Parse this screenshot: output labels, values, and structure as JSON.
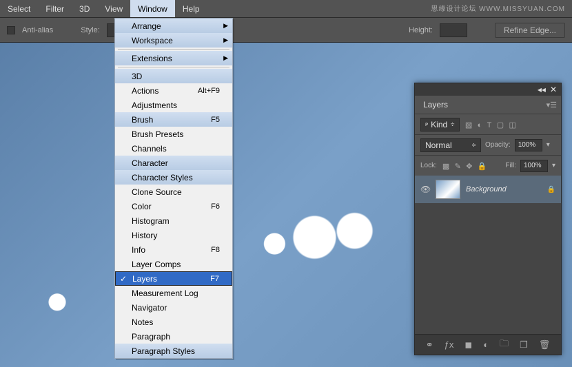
{
  "watermark": "思缘设计论坛  WWW.MISSYUAN.COM",
  "menubar": {
    "items": [
      "Select",
      "Filter",
      "3D",
      "View",
      "Window",
      "Help"
    ],
    "open_index": 4
  },
  "optbar": {
    "antialias": "Anti-alias",
    "style": "Style:",
    "height_label": "Height:",
    "refine": "Refine Edge..."
  },
  "dropdown": {
    "sections": [
      [
        {
          "label": "Arrange",
          "arrow": true,
          "hl": true
        },
        {
          "label": "Workspace",
          "arrow": true,
          "hl": true
        }
      ],
      [
        {
          "label": "Extensions",
          "arrow": true,
          "hl": true
        }
      ],
      [
        {
          "label": "3D",
          "hl": true
        },
        {
          "label": "Actions",
          "shortcut": "Alt+F9"
        },
        {
          "label": "Adjustments"
        },
        {
          "label": "Brush",
          "shortcut": "F5",
          "hl": true
        },
        {
          "label": "Brush Presets"
        },
        {
          "label": "Channels"
        },
        {
          "label": "Character",
          "hl": true
        },
        {
          "label": "Character Styles",
          "hl": true
        },
        {
          "label": "Clone Source"
        },
        {
          "label": "Color",
          "shortcut": "F6"
        },
        {
          "label": "Histogram"
        },
        {
          "label": "History"
        },
        {
          "label": "Info",
          "shortcut": "F8"
        },
        {
          "label": "Layer Comps"
        },
        {
          "label": "Layers",
          "shortcut": "F7",
          "sel": true,
          "check": true
        },
        {
          "label": "Measurement Log"
        },
        {
          "label": "Navigator"
        },
        {
          "label": "Notes"
        },
        {
          "label": "Paragraph"
        },
        {
          "label": "Paragraph Styles",
          "hl": true
        }
      ]
    ]
  },
  "panel": {
    "tab": "Layers",
    "kind": "Kind",
    "blend": "Normal",
    "opacity_label": "Opacity:",
    "opacity_value": "100%",
    "lock_label": "Lock:",
    "fill_label": "Fill:",
    "fill_value": "100%",
    "layer": {
      "name": "Background"
    }
  }
}
